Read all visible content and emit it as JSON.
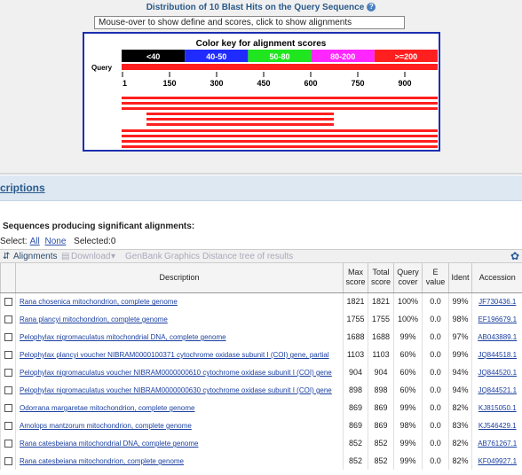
{
  "graphic": {
    "title": "Distribution of 10 Blast Hits on the Query Sequence",
    "help_icon": "help-icon",
    "mouseover_text": "Mouse-over to show define and scores, click to show alignments",
    "color_key_title": "Color key for alignment scores",
    "color_key": [
      {
        "label": "<40",
        "color": "#000000"
      },
      {
        "label": "40-50",
        "color": "#1f2bff"
      },
      {
        "label": "50-80",
        "color": "#1fe61f"
      },
      {
        "label": "80-200",
        "color": "#ff26ff"
      },
      {
        "label": ">=200",
        "color": "#ff1f1f"
      }
    ],
    "query_label": "Query",
    "ruler_ticks": [
      "1",
      "150",
      "300",
      "450",
      "600",
      "750",
      "900"
    ],
    "hit_color": "#ff1f1f"
  },
  "section": {
    "title": "criptions"
  },
  "sig_title": "Sequences producing significant alignments:",
  "select": {
    "label": "Select:",
    "all": "All",
    "none": "None",
    "selected": "Selected:0"
  },
  "toolbar": {
    "alignments": "Alignments",
    "download": "Download",
    "genbank": "GenBank",
    "graphics": "Graphics",
    "distance_tree": "Distance tree of results"
  },
  "table": {
    "headers": {
      "description": "Description",
      "max_score": "Max score",
      "total_score": "Total score",
      "query_cover": "Query cover",
      "evalue": "E value",
      "ident": "Ident",
      "accession": "Accession"
    },
    "rows": [
      {
        "description": "Rana chosenica mitochondrion, complete genome",
        "max": "1821",
        "total": "1821",
        "cover": "100%",
        "e": "0.0",
        "ident": "99%",
        "acc": "JF730436.1"
      },
      {
        "description": "Rana plancyi mitochondrion, complete genome",
        "max": "1755",
        "total": "1755",
        "cover": "100%",
        "e": "0.0",
        "ident": "98%",
        "acc": "EF196679.1"
      },
      {
        "description": "Pelophylax nigromaculatus mitochondrial DNA, complete genome",
        "max": "1688",
        "total": "1688",
        "cover": "99%",
        "e": "0.0",
        "ident": "97%",
        "acc": "AB043889.1"
      },
      {
        "description": "Pelophylax plancyi voucher NIBRAM0000100371 cytochrome oxidase subunit I (COI) gene, partial",
        "max": "1103",
        "total": "1103",
        "cover": "60%",
        "e": "0.0",
        "ident": "99%",
        "acc": "JQ844518.1"
      },
      {
        "description": "Pelophylax nigromaculatus voucher NIBRAM0000000610 cytochrome oxidase subunit I (COI) gene",
        "max": "904",
        "total": "904",
        "cover": "60%",
        "e": "0.0",
        "ident": "94%",
        "acc": "JQ844520.1"
      },
      {
        "description": "Pelophylax nigromaculatus voucher NIBRAM0000000630 cytochrome oxidase subunit I (COI) gene",
        "max": "898",
        "total": "898",
        "cover": "60%",
        "e": "0.0",
        "ident": "94%",
        "acc": "JQ844521.1"
      },
      {
        "description": "Odorrana margaretae mitochondrion, complete genome",
        "max": "869",
        "total": "869",
        "cover": "99%",
        "e": "0.0",
        "ident": "82%",
        "acc": "KJ815050.1"
      },
      {
        "description": "Amolops mantzorum mitochondrion, complete genome",
        "max": "869",
        "total": "869",
        "cover": "98%",
        "e": "0.0",
        "ident": "83%",
        "acc": "KJ546429.1"
      },
      {
        "description": "Rana catesbeiana mitochondrial DNA, complete genome",
        "max": "852",
        "total": "852",
        "cover": "99%",
        "e": "0.0",
        "ident": "82%",
        "acc": "AB761267.1"
      },
      {
        "description": "Rana catesbeiana mitochondrion, complete genome",
        "max": "852",
        "total": "852",
        "cover": "99%",
        "e": "0.0",
        "ident": "82%",
        "acc": "KF049927.1"
      }
    ]
  }
}
